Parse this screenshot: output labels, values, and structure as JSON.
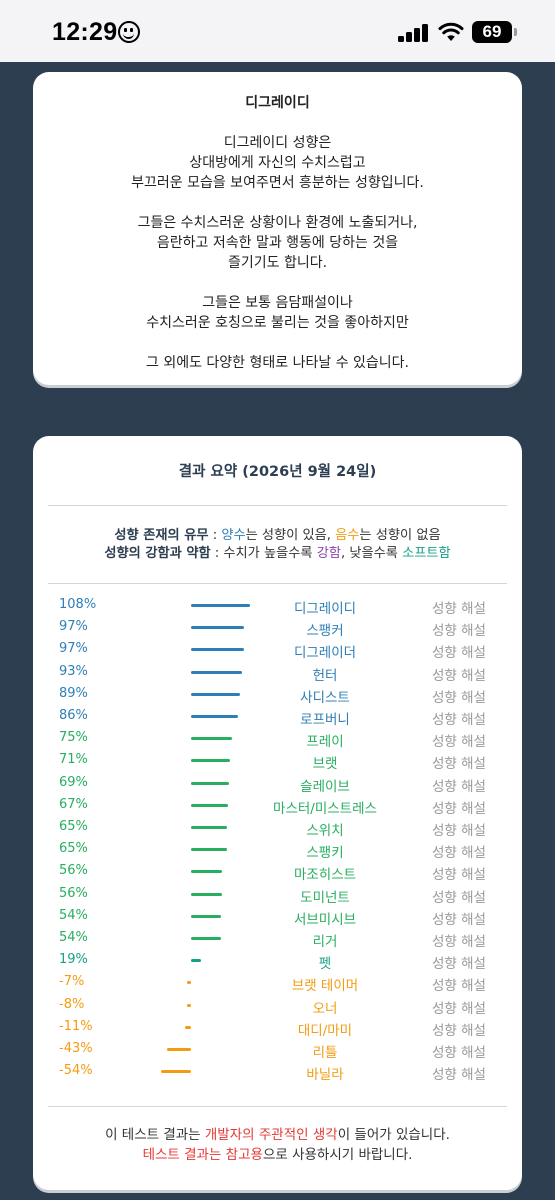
{
  "status_bar": {
    "time": "12:29",
    "battery": "69"
  },
  "intro_card": {
    "title": "디그레이디",
    "paragraphs": [
      "디그레이디 성향은\n상대방에게 자신의 수치스럽고\n부끄러운 모습을 보여주면서 흥분하는 성향입니다.",
      "그들은 수치스러운 상황이나 환경에 노출되거나,\n음란하고 저속한 말과 행동에 당하는 것을\n즐기기도 합니다.",
      "그들은 보통 음담패설이나\n수치스러운 호칭으로 불리는 것을 좋아하지만",
      "그 외에도 다양한 형태로 나타날 수 있습니다."
    ]
  },
  "summary": {
    "title": "결과 요약 (2026년 9월 24일)",
    "legend1": {
      "label": "성향 존재의 유무",
      "sep": " : ",
      "positive": "양수",
      "positive_text": "는 성향이 있음, ",
      "negative": "음수",
      "negative_text": "는 성향이 없음"
    },
    "legend2": {
      "label": "성향의 강함과 약함",
      "sep": " : 수치가 높을수록 ",
      "strong": "강함",
      "mid": ", 낮을수록 ",
      "soft": "소프트함"
    },
    "detail_label": "성향 해설",
    "colors": {
      "blue": "#2e7fb8",
      "green": "#27ae60",
      "teal": "#16a085",
      "orange": "#f39c12",
      "purple": "#8e44ad",
      "red": "#e53935"
    },
    "rows": [
      {
        "pct": "108%",
        "value": 108,
        "name": "디그레이디",
        "color": "#2e7fb8"
      },
      {
        "pct": "97%",
        "value": 97,
        "name": "스팽커",
        "color": "#2e7fb8"
      },
      {
        "pct": "97%",
        "value": 97,
        "name": "디그레이더",
        "color": "#2e7fb8"
      },
      {
        "pct": "93%",
        "value": 93,
        "name": "헌터",
        "color": "#2e7fb8"
      },
      {
        "pct": "89%",
        "value": 89,
        "name": "사디스트",
        "color": "#2e7fb8"
      },
      {
        "pct": "86%",
        "value": 86,
        "name": "로프버니",
        "color": "#2e7fb8"
      },
      {
        "pct": "75%",
        "value": 75,
        "name": "프레이",
        "color": "#27ae60"
      },
      {
        "pct": "71%",
        "value": 71,
        "name": "브랫",
        "color": "#27ae60"
      },
      {
        "pct": "69%",
        "value": 69,
        "name": "슬레이브",
        "color": "#27ae60"
      },
      {
        "pct": "67%",
        "value": 67,
        "name": "마스터/미스트레스",
        "color": "#27ae60"
      },
      {
        "pct": "65%",
        "value": 65,
        "name": "스위치",
        "color": "#27ae60"
      },
      {
        "pct": "65%",
        "value": 65,
        "name": "스팽키",
        "color": "#27ae60"
      },
      {
        "pct": "56%",
        "value": 56,
        "name": "마조히스트",
        "color": "#27ae60"
      },
      {
        "pct": "56%",
        "value": 56,
        "name": "도미넌트",
        "color": "#27ae60"
      },
      {
        "pct": "54%",
        "value": 54,
        "name": "서브미시브",
        "color": "#27ae60"
      },
      {
        "pct": "54%",
        "value": 54,
        "name": "리거",
        "color": "#27ae60"
      },
      {
        "pct": "19%",
        "value": 19,
        "name": "펫",
        "color": "#16a085"
      },
      {
        "pct": "-7%",
        "value": -7,
        "name": "브랫 테이머",
        "color": "#f39c12"
      },
      {
        "pct": "-8%",
        "value": -8,
        "name": "오너",
        "color": "#f39c12"
      },
      {
        "pct": "-11%",
        "value": -11,
        "name": "대디/마미",
        "color": "#f39c12"
      },
      {
        "pct": "-43%",
        "value": -43,
        "name": "리틀",
        "color": "#f39c12"
      },
      {
        "pct": "-54%",
        "value": -54,
        "name": "바닐라",
        "color": "#f39c12"
      }
    ]
  },
  "footer": {
    "line1_a": "이 테스트 결과는 ",
    "line1_red": "개발자의 주관적인 생각",
    "line1_b": "이 들어가 있습니다.",
    "line2_red": "테스트 결과는 참고용",
    "line2_b": "으로 사용하시기 바랍니다."
  }
}
